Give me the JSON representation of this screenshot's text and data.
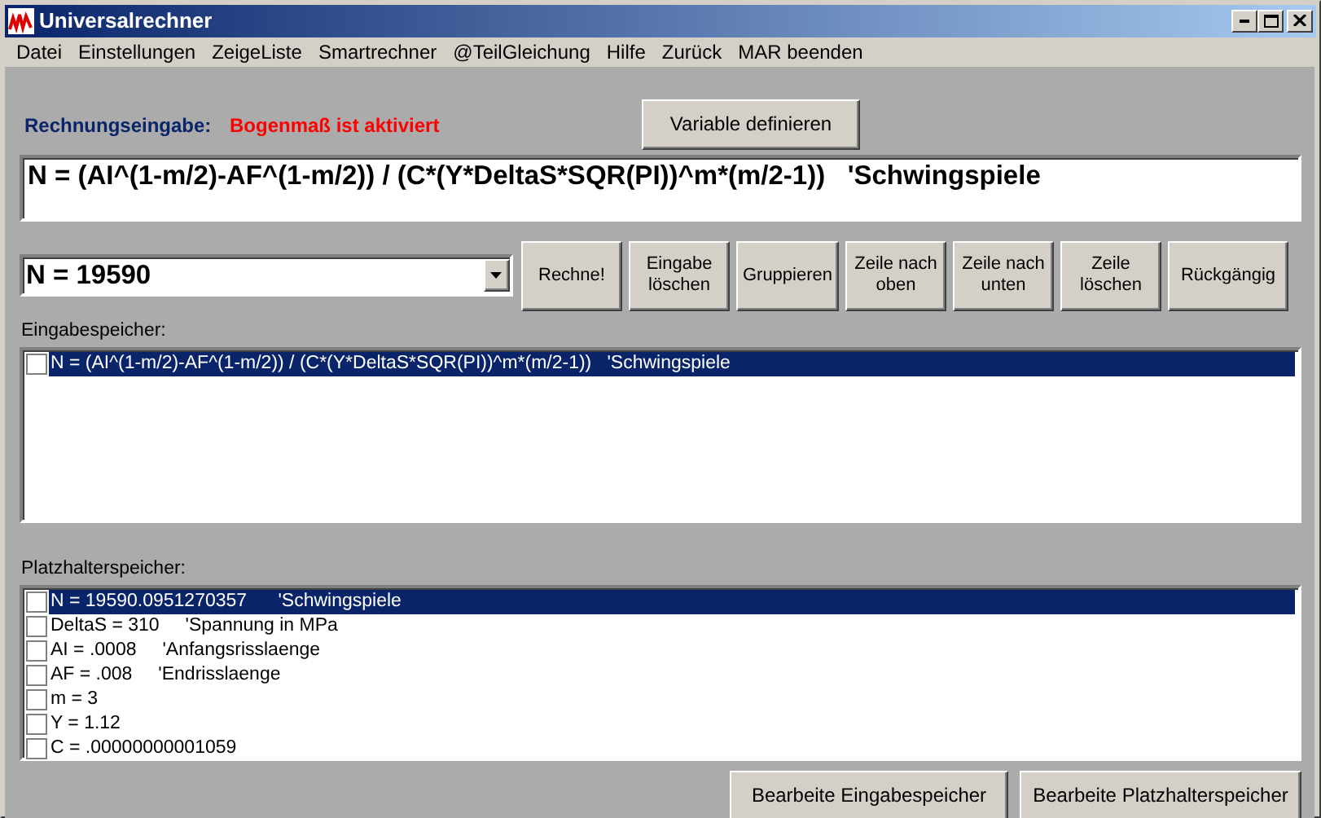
{
  "window": {
    "title": "Universalrechner"
  },
  "menu": [
    "Datei",
    "Einstellungen",
    "ZeigeListe",
    "Smartrechner",
    "@TeilGleichung",
    "Hilfe",
    "Zurück",
    "MAR beenden"
  ],
  "input_label": "Rechnungseingabe:",
  "mode_notice": "Bogenmaß ist aktiviert",
  "define_button": "Variable definieren",
  "formula": "N = (AI^(1-m/2)-AF^(1-m/2)) / (C*(Y*DeltaS*SQR(PI))^m*(m/2-1))   'Schwingspiele",
  "result_combo": "N = 19590",
  "actions": [
    "Rechne!",
    "Eingabe löschen",
    "Gruppieren",
    "Zeile nach oben",
    "Zeile nach unten",
    "Zeile löschen",
    "Rückgängig"
  ],
  "input_store": {
    "label": "Eingabespeicher:",
    "items": [
      {
        "text": "N = (AI^(1-m/2)-AF^(1-m/2)) / (C*(Y*DeltaS*SQR(PI))^m*(m/2-1))   'Schwingspiele",
        "checked": false,
        "selected": true
      }
    ]
  },
  "placeholder_store": {
    "label": "Platzhalterspeicher:",
    "items": [
      {
        "text": "N = 19590.0951270357      'Schwingspiele",
        "checked": false,
        "selected": true
      },
      {
        "text": "DeltaS = 310     'Spannung in MPa",
        "checked": false,
        "selected": false
      },
      {
        "text": "AI = .0008     'Anfangsrisslaenge",
        "checked": false,
        "selected": false
      },
      {
        "text": "AF = .008     'Endrisslaenge",
        "checked": false,
        "selected": false
      },
      {
        "text": "m = 3",
        "checked": false,
        "selected": false
      },
      {
        "text": "Y = 1.12",
        "checked": false,
        "selected": false
      },
      {
        "text": "C = .00000000001059",
        "checked": false,
        "selected": false
      }
    ]
  },
  "bottom_buttons": [
    "Bearbeite Eingabespeicher",
    "Bearbeite Platzhalterspeicher"
  ]
}
